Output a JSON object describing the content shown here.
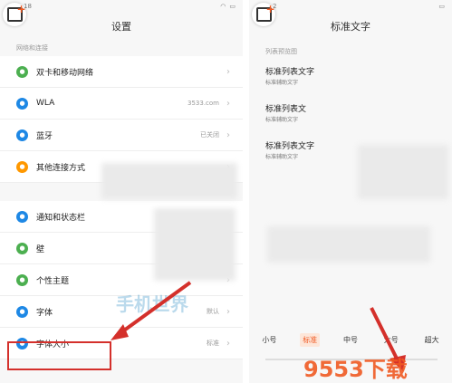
{
  "left": {
    "status_time": "18",
    "title": "设置",
    "section_network": "网络和连接",
    "items_network": [
      {
        "label": "双卡和移动网络",
        "value": "",
        "icon": "sim-icon",
        "color": "#4caf50"
      },
      {
        "label": "WLA",
        "value": "3533.com",
        "icon": "wifi-icon",
        "color": "#1e88e5"
      },
      {
        "label": "蓝牙",
        "value": "已关闭",
        "icon": "bluetooth-icon",
        "color": "#1e88e5"
      },
      {
        "label": "其他连接方式",
        "value": "",
        "icon": "link-icon",
        "color": "#ff9800"
      }
    ],
    "items_personal": [
      {
        "label": "通知和状态栏",
        "value": "",
        "icon": "notification-icon",
        "color": "#1e88e5"
      },
      {
        "label": "壁",
        "value": "",
        "icon": "wallpaper-icon",
        "color": "#4caf50"
      },
      {
        "label": "个性主题",
        "value": "",
        "icon": "theme-icon",
        "color": "#4caf50"
      },
      {
        "label": "字体",
        "value": "默认",
        "icon": "font-icon",
        "color": "#1e88e5"
      },
      {
        "label": "字体大小",
        "value": "标准",
        "icon": "font-size-icon",
        "color": "#1e88e5"
      }
    ]
  },
  "right": {
    "status_time": "2",
    "title": "标准文字",
    "preview_label": "列表预览图",
    "preview_items": [
      {
        "main": "标准列表文字",
        "sub": "标准辅助文字"
      },
      {
        "main": "标准列表文",
        "sub": "标准辅助文字"
      },
      {
        "main": "标准列表文字",
        "sub": "标准辅助文字"
      }
    ],
    "sizes": [
      "小号",
      "标准",
      "中号",
      "大号",
      "超大"
    ],
    "selected_size": "标准"
  },
  "watermark": {
    "text": "9553下载",
    "accent": "#f05a23"
  },
  "colors": {
    "arrow": "#d4302b",
    "accent": "#f05a23"
  }
}
